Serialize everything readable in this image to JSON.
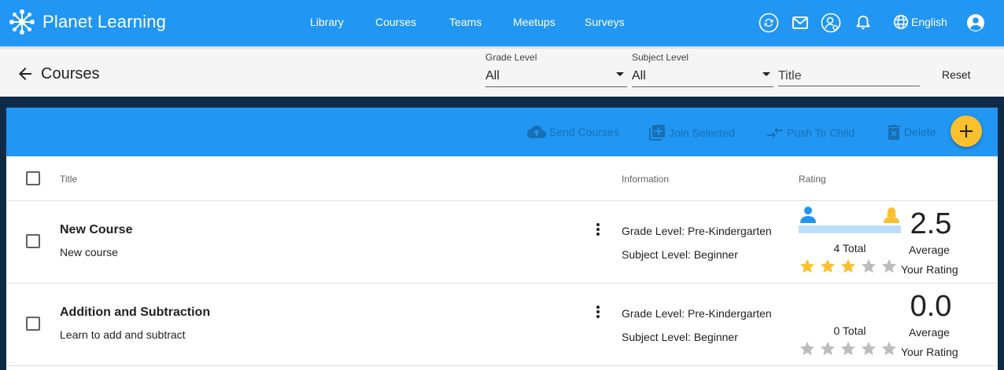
{
  "app": {
    "name": "Planet Learning"
  },
  "nav": [
    "Library",
    "Courses",
    "Teams",
    "Meetups",
    "Surveys"
  ],
  "header_icons": [
    "sync-icon",
    "mail-icon",
    "user-settings-icon",
    "bell-icon",
    "globe-icon",
    "account-icon"
  ],
  "language": "English",
  "page": {
    "title": "Courses"
  },
  "filters": {
    "grade_label": "Grade Level",
    "grade_value": "All",
    "subject_label": "Subject Level",
    "subject_value": "All",
    "title_placeholder": "Title",
    "reset": "Reset"
  },
  "toolbar": {
    "send": "Send Courses",
    "join": "Join Selected",
    "push": "Push To Child",
    "delete": "Delete"
  },
  "columns": {
    "title": "Title",
    "information": "Information",
    "rating": "Rating"
  },
  "courses": [
    {
      "title": "New Course",
      "description": "New course",
      "grade": "Grade Level: Pre-Kindergarten",
      "subject": "Subject Level: Beginner",
      "total": "4 Total",
      "average": "2.5",
      "average_label": "Average",
      "your_rating_label": "Your Rating",
      "stars_filled": 3,
      "stars_max": 5,
      "show_gender_bar": true
    },
    {
      "title": "Addition and Subtraction",
      "description": "Learn to add and subtract",
      "grade": "Grade Level: Pre-Kindergarten",
      "subject": "Subject Level: Beginner",
      "total": "0 Total",
      "average": "0.0",
      "average_label": "Average",
      "your_rating_label": "Your Rating",
      "stars_filled": 0,
      "stars_max": 5,
      "show_gender_bar": false
    }
  ],
  "colors": {
    "primary": "#2196f3",
    "accent": "#fbc02d",
    "star_filled": "#fbc02d",
    "star_empty": "#bdbdbd",
    "male_icon": "#2196f3",
    "female_icon": "#fbc02d"
  }
}
